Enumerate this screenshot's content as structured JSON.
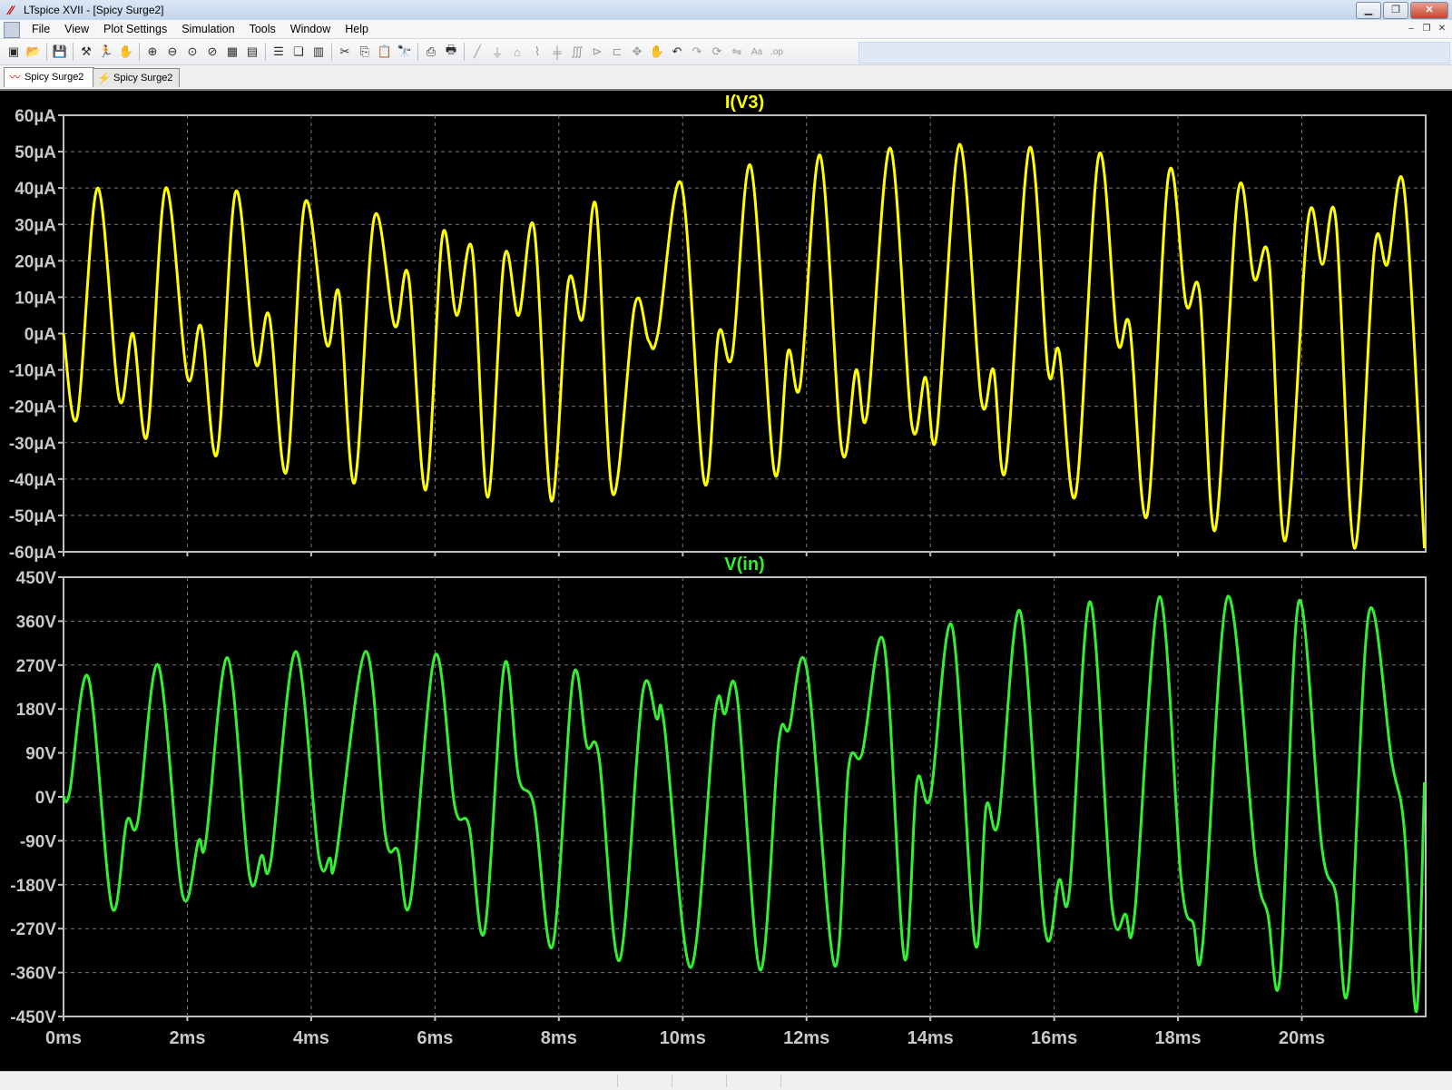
{
  "window": {
    "title": "LTspice XVII - [Spicy Surge2]",
    "app_icon": "ltspice-logo-icon",
    "buttons": {
      "minimize": "minimize-icon",
      "maximize": "restore-icon",
      "close": "close-icon"
    }
  },
  "menu": {
    "items": [
      "File",
      "View",
      "Plot Settings",
      "Simulation",
      "Tools",
      "Window",
      "Help"
    ]
  },
  "toolbar": {
    "icons": [
      "new-schematic-icon",
      "open-icon",
      "save-icon",
      "control-panel-icon",
      "run-icon",
      "halt-icon",
      "zoom-in-icon",
      "zoom-out-icon",
      "zoom-fit-icon",
      "cancel-zoom-icon",
      "autorange-icon",
      "plot-settings-icon",
      "tile-horizontal-icon",
      "cascade-icon",
      "tile-vertical-icon",
      "cut-icon",
      "copy-icon",
      "paste-icon",
      "find-icon",
      "print-preview-icon",
      "print-icon",
      "wire-icon",
      "ground-icon",
      "label-icon",
      "resistor-icon",
      "capacitor-icon",
      "inductor-icon",
      "diode-icon",
      "component-icon",
      "move-icon",
      "drag-icon",
      "undo-icon",
      "redo-icon",
      "rotate-icon",
      "mirror-icon",
      "text-icon",
      "spice-directive-icon"
    ]
  },
  "tabs": [
    {
      "label": "Spicy Surge2",
      "icon": "waveform-icon",
      "active": true
    },
    {
      "label": "Spicy Surge2",
      "icon": "schematic-icon",
      "active": false
    }
  ],
  "colors": {
    "trace_current": "#ffff00",
    "trace_voltage": "#33ee33",
    "grid": "#7a7a7a",
    "frame": "#c0c0c0",
    "axis_text": "#c8c8c8",
    "plot_bg": "#000000"
  },
  "chart_data": [
    {
      "type": "line",
      "title": "I(V3)",
      "xlabel": "",
      "ylabel": "",
      "xlim": [
        0,
        22
      ],
      "ylim": [
        -60,
        60
      ],
      "x_ticks": [
        "0ms",
        "2ms",
        "4ms",
        "6ms",
        "8ms",
        "10ms",
        "12ms",
        "14ms",
        "16ms",
        "18ms",
        "20ms"
      ],
      "y_ticks": [
        "60µA",
        "50µA",
        "40µA",
        "30µA",
        "20µA",
        "10µA",
        "0µA",
        "-10µA",
        "-20µA",
        "-30µA",
        "-40µA",
        "-50µA",
        "-60µA"
      ],
      "grid": true,
      "series": [
        {
          "name": "I(V3)",
          "x": [
            0,
            0.22,
            0.55,
            0.9,
            1.12,
            1.35,
            1.65,
            2.0,
            2.22,
            2.48,
            2.78,
            3.1,
            3.32,
            3.6,
            3.9,
            4.25,
            4.45,
            4.7,
            5.02,
            5.35,
            5.57,
            5.85,
            6.12,
            6.35,
            6.6,
            6.85,
            7.12,
            7.35,
            7.6,
            7.88,
            8.15,
            8.38,
            8.6,
            8.87,
            9.23,
            9.45,
            9.6,
            9.98,
            10.35,
            10.58,
            10.8,
            11.1,
            11.48,
            11.7,
            11.9,
            12.22,
            12.57,
            12.8,
            12.98,
            13.35,
            13.7,
            13.92,
            14.1,
            14.47,
            14.82,
            15.02,
            15.22,
            15.6,
            15.9,
            16.08,
            16.35,
            16.72,
            17.02,
            17.22,
            17.5,
            17.85,
            18.13,
            18.35,
            18.6,
            18.97,
            19.23,
            19.47,
            19.73,
            20.1,
            20.33,
            20.55,
            20.85,
            21.17,
            21.38,
            21.65,
            21.98
          ],
          "values": [
            0,
            -23,
            40,
            -18,
            0,
            -28,
            40,
            -12,
            2,
            -33,
            39,
            -8,
            5,
            -38,
            36,
            -3,
            11,
            -41,
            32,
            2,
            16,
            -43,
            27,
            5,
            23,
            -45,
            21,
            5,
            29,
            -46,
            14,
            4,
            35,
            -44,
            8,
            -2,
            0,
            41,
            -41,
            0,
            -6,
            46,
            -38,
            -5,
            -14,
            49,
            -32,
            -10,
            -22,
            51,
            -25,
            -12,
            -28,
            52,
            -18,
            -10,
            -37,
            51,
            -10,
            -5,
            -44,
            49,
            -2,
            2,
            -50,
            44,
            8,
            11,
            -54,
            39,
            15,
            20,
            -57,
            31,
            19,
            31,
            -59,
            23,
            19,
            40,
            -59
          ]
        }
      ]
    },
    {
      "type": "line",
      "title": "V(in)",
      "xlabel": "",
      "ylabel": "",
      "xlim": [
        0,
        22
      ],
      "ylim": [
        -450,
        450
      ],
      "x_ticks": [
        "0ms",
        "2ms",
        "4ms",
        "6ms",
        "8ms",
        "10ms",
        "12ms",
        "14ms",
        "16ms",
        "18ms",
        "20ms"
      ],
      "y_ticks": [
        "450V",
        "360V",
        "270V",
        "180V",
        "90V",
        "0V",
        "-90V",
        "-180V",
        "-270V",
        "-360V",
        "-450V"
      ],
      "grid": true,
      "series": [
        {
          "name": "V(in)",
          "x": [
            0,
            0.1,
            0.4,
            0.78,
            1.02,
            1.2,
            1.53,
            1.92,
            2.18,
            2.3,
            2.65,
            3.0,
            3.2,
            3.35,
            3.75,
            4.12,
            4.3,
            4.4,
            4.88,
            5.2,
            5.4,
            5.6,
            6.0,
            6.32,
            6.55,
            6.8,
            7.12,
            7.35,
            7.6,
            7.9,
            8.23,
            8.45,
            8.65,
            8.98,
            9.35,
            9.58,
            9.7,
            10.13,
            10.52,
            10.68,
            10.88,
            11.25,
            11.55,
            11.72,
            12.0,
            12.45,
            12.68,
            12.9,
            13.25,
            13.58,
            13.78,
            14.0,
            14.35,
            14.72,
            14.9,
            15.1,
            15.45,
            15.85,
            16.08,
            16.25,
            16.58,
            16.93,
            17.15,
            17.3,
            17.7,
            18.05,
            18.25,
            18.4,
            18.8,
            19.25,
            19.45,
            19.65,
            19.95,
            20.32,
            20.55,
            20.75,
            21.08,
            21.45,
            21.65,
            21.85,
            21.98
          ],
          "values": [
            0,
            10,
            245,
            -225,
            -50,
            -50,
            270,
            -200,
            -90,
            -90,
            285,
            -160,
            -120,
            -130,
            298,
            -120,
            -125,
            -125,
            298,
            -80,
            -110,
            -215,
            290,
            -20,
            -60,
            -275,
            270,
            40,
            -20,
            -305,
            245,
            105,
            80,
            -335,
            210,
            160,
            150,
            -350,
            170,
            170,
            205,
            -355,
            110,
            140,
            265,
            -345,
            60,
            90,
            315,
            -330,
            30,
            0,
            350,
            -300,
            -20,
            -50,
            380,
            -270,
            -170,
            -190,
            400,
            -220,
            -240,
            -240,
            410,
            -170,
            -260,
            -300,
            410,
            -130,
            -240,
            -365,
            400,
            -100,
            -200,
            -390,
            375,
            75,
            -60,
            -440,
            30
          ]
        }
      ]
    }
  ]
}
